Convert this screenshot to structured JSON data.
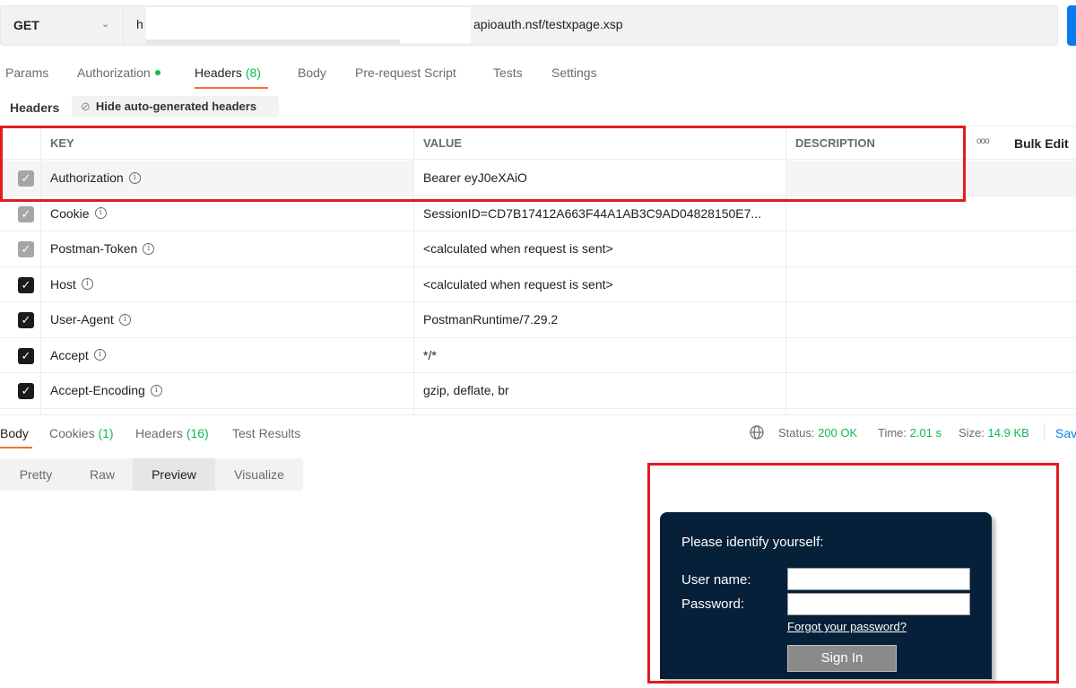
{
  "request": {
    "method": "GET",
    "url_prefix": "h",
    "url_suffix": "apioauth.nsf/testxpage.xsp"
  },
  "request_tabs": [
    {
      "label": "Params"
    },
    {
      "label": "Authorization"
    },
    {
      "label": "Headers",
      "count": "(8)"
    },
    {
      "label": "Body"
    },
    {
      "label": "Pre-request Script"
    },
    {
      "label": "Tests"
    },
    {
      "label": "Settings"
    }
  ],
  "headers_section": {
    "title": "Headers",
    "hide_button": "Hide auto-generated headers"
  },
  "table": {
    "columns": {
      "key": "KEY",
      "value": "VALUE",
      "description": "DESCRIPTION"
    },
    "more_icon": "ooo",
    "bulk_edit": "Bulk Edit",
    "rows": [
      {
        "key": "Authorization",
        "value": "Bearer eyJ0eXAiO",
        "checked": true,
        "disabled": true
      },
      {
        "key": "Cookie",
        "value": "SessionID=CD7B17412A663F44A1AB3C9AD04828150E7...",
        "checked": true,
        "disabled": true
      },
      {
        "key": "Postman-Token",
        "value": "<calculated when request is sent>",
        "checked": true,
        "disabled": true
      },
      {
        "key": "Host",
        "value": "<calculated when request is sent>",
        "checked": true,
        "disabled": false
      },
      {
        "key": "User-Agent",
        "value": "PostmanRuntime/7.29.2",
        "checked": true,
        "disabled": false
      },
      {
        "key": "Accept",
        "value": "*/*",
        "checked": true,
        "disabled": false
      },
      {
        "key": "Accept-Encoding",
        "value": "gzip, deflate, br",
        "checked": true,
        "disabled": false
      }
    ]
  },
  "response_tabs": {
    "body": "Body",
    "cookies": "Cookies",
    "cookies_count": "(1)",
    "headers": "Headers",
    "headers_count": "(16)",
    "test_results": "Test Results"
  },
  "status": {
    "status_label": "Status:",
    "status_value": "200 OK",
    "time_label": "Time:",
    "time_value": "2.01 s",
    "size_label": "Size:",
    "size_value": "14.9 KB",
    "save": "Sav"
  },
  "view_modes": [
    "Pretty",
    "Raw",
    "Preview",
    "Visualize"
  ],
  "selected_view": "Preview",
  "preview": {
    "title": "Please identify yourself:",
    "username_label": "User name:",
    "password_label": "Password:",
    "forgot": "Forgot your password?",
    "sign_in": "Sign In"
  },
  "colors": {
    "accent": "#ff6c37",
    "status_green": "#0cbb52",
    "send_blue": "#097bed",
    "highlight_red": "#e21b23",
    "login_bg": "#062039"
  }
}
